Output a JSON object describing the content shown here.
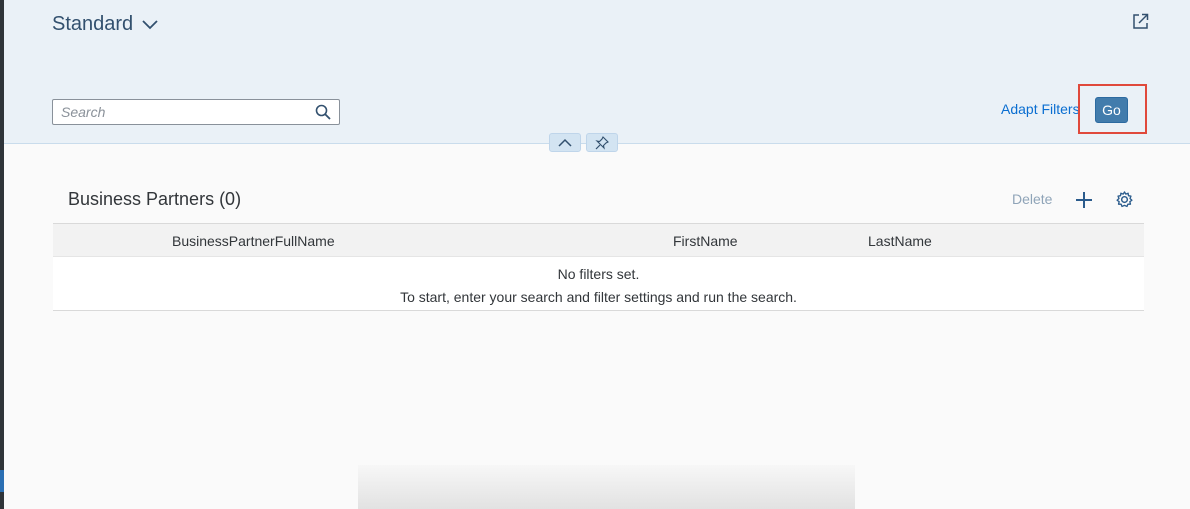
{
  "header": {
    "variant_title": "Standard",
    "search_placeholder": "Search",
    "search_value": "",
    "adapt_filters_label": "Adapt Filters",
    "go_label": "Go"
  },
  "table": {
    "title": "Business Partners (0)",
    "delete_label": "Delete",
    "columns": [
      "BusinessPartnerFullName",
      "FirstName",
      "LastName"
    ],
    "empty_message_line1": "No filters set.",
    "empty_message_line2": "To start, enter your search and filter settings and run the search."
  },
  "icons": {
    "variant_dropdown": "chevron-down-icon",
    "share": "share-icon",
    "search": "search-icon",
    "collapse_header": "chevron-up-icon",
    "pin_header": "pin-icon",
    "add": "add-icon",
    "settings": "gear-icon"
  },
  "colors": {
    "header_background": "#eaf1f7",
    "link": "#0a6ed1",
    "go_button": "#427cac",
    "highlight": "#e0493b",
    "disabled_text": "#8fa4b8"
  }
}
